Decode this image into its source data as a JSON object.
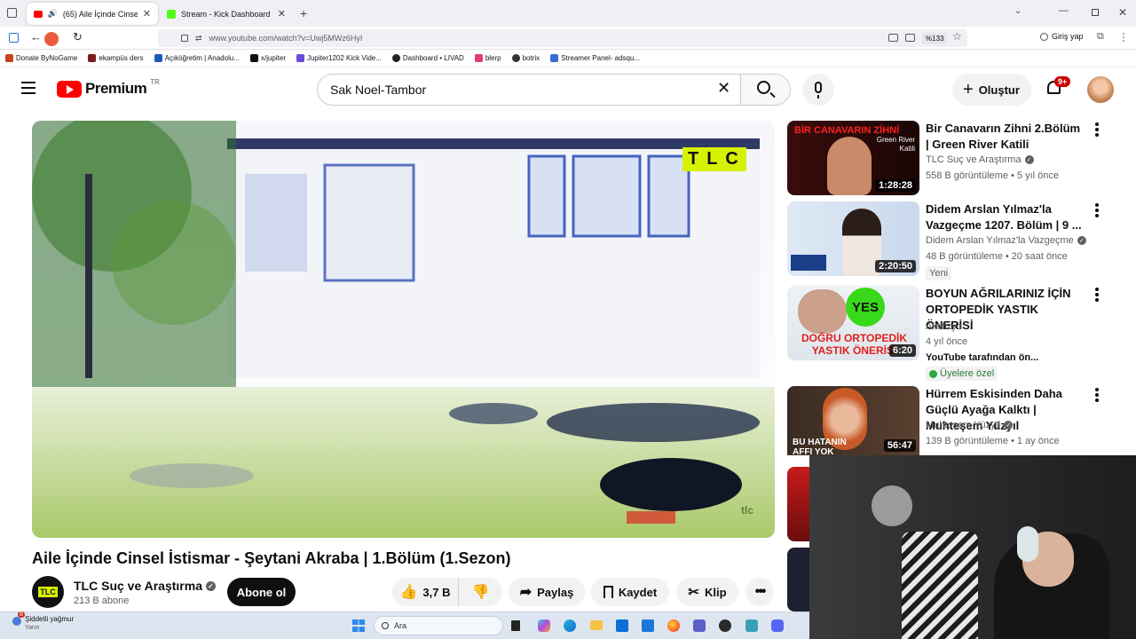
{
  "tabs": [
    {
      "label": "(65) Aile İçinde Cinsel İstism",
      "active": true
    },
    {
      "label": "Stream - Kick Dashboard",
      "active": false
    }
  ],
  "url": "www.youtube.com/watch?v=Uwj5MWz6HyI",
  "zoom": "%133",
  "signin_label": "Giriş yap",
  "bookmarks": [
    "Donate ByNoGame",
    "ekampüs ders",
    "Açıköğretim | Anadolu...",
    "x/jupiter",
    "Jupiter1202 Kick Vide...",
    "Dashboard • LIVAD",
    "blerp",
    "botrix",
    "Streamer Panel- adsqu..."
  ],
  "yt": {
    "logo_text": "Premium",
    "logo_sup": "TR",
    "search_value": "Sak Noel-Tambor",
    "create_label": "Oluştur",
    "notif_count": "9+"
  },
  "video": {
    "watermark": "TLC",
    "watermark_small": "tlc",
    "title": "Aile İçinde Cinsel İstismar - Şeytani Akraba | 1.Bölüm (1.Sezon)",
    "channel": "TLC Suç ve Araştırma",
    "channel_avatar_text": "TLC",
    "subscribers": "213 B abone",
    "subscribe_label": "Abone ol",
    "likes": "3,7 B",
    "share_label": "Paylaş",
    "save_label": "Kaydet",
    "clip_label": "Klip"
  },
  "recommendations": [
    {
      "title": "Bir Canavarın Zihni 2.Bölüm | Green River Katili",
      "channel": "TLC Suç ve Araştırma",
      "verified": true,
      "stats": "558 B görüntüleme • 5 yıl önce",
      "duration": "1:28:28",
      "thumb_text": "BİR CANAVARIN ZİHNİ",
      "thumb_sub": "Green River Katili",
      "badge": ""
    },
    {
      "title": "Didem Arslan Yılmaz'la Vazgeçme 1207. Bölüm | 9 ...",
      "channel": "Didem Arslan Yılmaz'la Vazgeçme",
      "verified": true,
      "stats": "48 B görüntüleme • 20 saat önce",
      "duration": "2:20:50",
      "badge": "Yeni"
    },
    {
      "title": "BOYUN AĞRILARINIZ İÇİN ORTOPEDİK YASTIK ÖNERİSİ",
      "channel": "Aktifizyo",
      "verified": false,
      "stats": "4 yıl önce",
      "extra": "YouTube tarafından ön...",
      "members": "Üyelere özel",
      "duration": "6:20",
      "thumb_text": "DOĞRU ORTOPEDİK YASTIK ÖNERİSİ",
      "thumb_yes": "YES"
    },
    {
      "title": "Hürrem Eskisinden Daha Güçlü Ayağa Kalktı | Muhteşem Yüzyıl",
      "channel": "Muhteşem Yüzyıl",
      "verified": true,
      "stats": "139 B görüntüleme • 1 ay önce",
      "duration": "56:47",
      "thumb_text": "BU HATANIN AFFI YOK"
    }
  ],
  "taskbar": {
    "weather_title": "Şiddetli yağmur",
    "weather_sub": "Yarın",
    "weather_badge": "8",
    "search_placeholder": "Ara"
  },
  "colors": {
    "yt_red": "#ff0000",
    "accent_blue": "#065fd4",
    "tlc_yellow": "#d7f200"
  }
}
